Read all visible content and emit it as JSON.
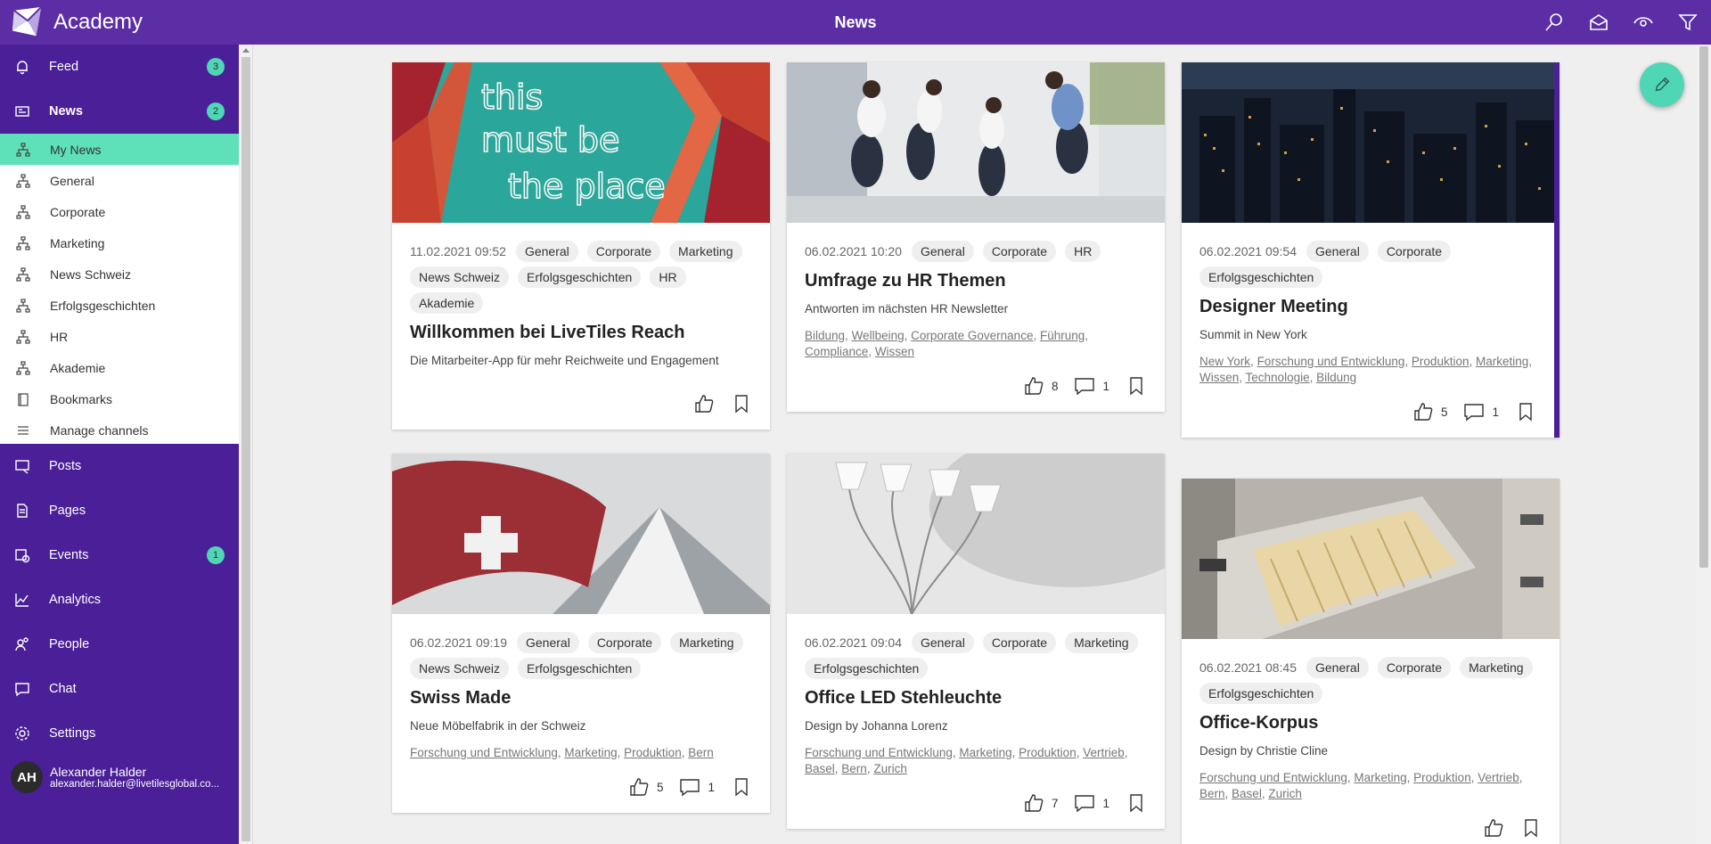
{
  "app": {
    "name": "Academy",
    "page_title": "News"
  },
  "top_icons": [
    "search-icon",
    "inbox-icon",
    "eye-icon",
    "filter-icon"
  ],
  "sidebar": {
    "top_items": [
      {
        "label": "Feed",
        "badge": "3",
        "icon": "bell-icon"
      },
      {
        "label": "News",
        "badge": "2",
        "icon": "newspaper-icon"
      }
    ],
    "sub_items": [
      {
        "label": "My News",
        "active": true
      },
      {
        "label": "General"
      },
      {
        "label": "Corporate"
      },
      {
        "label": "Marketing"
      },
      {
        "label": "News Schweiz"
      },
      {
        "label": "Erfolgsgeschichten"
      },
      {
        "label": "HR"
      },
      {
        "label": "Akademie"
      },
      {
        "label": "Bookmarks"
      },
      {
        "label": "Manage channels"
      }
    ],
    "bottom_items": [
      {
        "label": "Posts",
        "icon": "posts-icon"
      },
      {
        "label": "Pages",
        "icon": "pages-icon"
      },
      {
        "label": "Events",
        "badge": "1",
        "icon": "calendar-icon"
      },
      {
        "label": "Analytics",
        "icon": "analytics-icon"
      },
      {
        "label": "People",
        "icon": "people-icon"
      },
      {
        "label": "Chat",
        "icon": "chat-icon"
      },
      {
        "label": "Settings",
        "icon": "gear-icon"
      }
    ],
    "user": {
      "initials": "AH",
      "name": "Alexander Halder",
      "email": "alexander.halder@livetilesglobal.co..."
    }
  },
  "colors": {
    "brand": "#5b2ea6",
    "sidebar": "#4a1f97",
    "accent": "#4fd6b5"
  },
  "cards": [
    {
      "date": "11.02.2021 09:52",
      "tags": [
        "General",
        "Corporate",
        "Marketing",
        "News Schweiz",
        "Erfolgsgeschichten",
        "HR",
        "Akademie"
      ],
      "title": "Willkommen bei LiveTiles Reach",
      "subtitle": "Die Mitarbeiter-App für mehr Reichweite und Engagement",
      "links": [],
      "likes": "",
      "comments": ""
    },
    {
      "date": "06.02.2021 10:20",
      "tags": [
        "General",
        "Corporate",
        "HR"
      ],
      "title": "Umfrage zu HR Themen",
      "subtitle": "Antworten im nächsten HR Newsletter",
      "links": [
        "Bildung",
        "Wellbeing",
        "Corporate Governance",
        "Führung",
        "Compliance",
        "Wissen"
      ],
      "likes": "8",
      "comments": "1"
    },
    {
      "date": "06.02.2021 09:54",
      "tags": [
        "General",
        "Corporate",
        "Erfolgsgeschichten"
      ],
      "title": "Designer Meeting",
      "subtitle": "Summit in New York",
      "links": [
        "New York",
        "Forschung und Entwicklung",
        "Produktion",
        "Marketing",
        "Wissen",
        "Technologie",
        "Bildung"
      ],
      "likes": "5",
      "comments": "1"
    },
    {
      "date": "06.02.2021 09:19",
      "tags": [
        "General",
        "Corporate",
        "Marketing",
        "News Schweiz",
        "Erfolgsgeschichten"
      ],
      "title": "Swiss Made",
      "subtitle": "Neue Möbelfabrik in der Schweiz",
      "links": [
        "Forschung und Entwicklung",
        "Marketing",
        "Produktion",
        "Bern"
      ],
      "likes": "5",
      "comments": "1"
    },
    {
      "date": "06.02.2021 09:04",
      "tags": [
        "General",
        "Corporate",
        "Marketing",
        "Erfolgsgeschichten"
      ],
      "title": "Office LED Stehleuchte",
      "subtitle": "Design by Johanna Lorenz",
      "links": [
        "Forschung und Entwicklung",
        "Marketing",
        "Produktion",
        "Vertrieb",
        "Basel",
        "Bern",
        "Zurich"
      ],
      "likes": "7",
      "comments": "1"
    },
    {
      "date": "06.02.2021 08:45",
      "tags": [
        "General",
        "Corporate",
        "Marketing",
        "Erfolgsgeschichten"
      ],
      "title": "Office-Korpus",
      "subtitle": "Design by Christie Cline",
      "links": [
        "Forschung und Entwicklung",
        "Marketing",
        "Produktion",
        "Vertrieb",
        "Bern",
        "Basel",
        "Zurich"
      ],
      "likes": "",
      "comments": ""
    }
  ]
}
